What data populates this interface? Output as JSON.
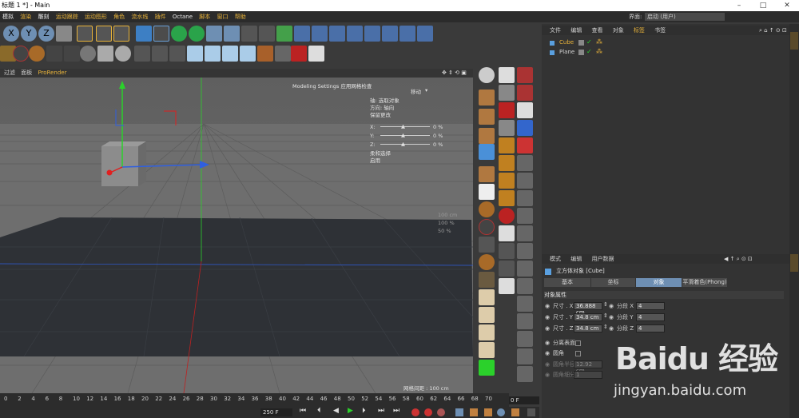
{
  "window": {
    "title": "标题 1 *] - Main",
    "minimize": "–",
    "maximize": "□",
    "close": "✕"
  },
  "menu": [
    "模拟",
    "渲染",
    "雕刻",
    "运动跟踪",
    "运动图形",
    "角色",
    "流水线",
    "插件",
    "Octane",
    "脚本",
    "窗口",
    "帮助"
  ],
  "layout": {
    "label": "界面:",
    "value": "启动 (用户)"
  },
  "viewport": {
    "menu": [
      "过滤",
      "面板",
      "ProRender"
    ],
    "header_text": "Modeling Settings 应用网格检查",
    "grid_label": "网格间距 : 100 cm",
    "tool_panel": {
      "dropdown": "移动",
      "lines": [
        "轴: 选取对象",
        "方向: 轴向",
        "保留更改",
        "",
        "X:",
        "Y:",
        "Z:",
        "柔和选择",
        "启用"
      ],
      "axis_values": [
        "0 %",
        "0 %",
        "0 %"
      ],
      "faded_values": [
        "100 cm",
        "100 %",
        "50 %"
      ]
    }
  },
  "object_manager": {
    "menu": [
      "文件",
      "编辑",
      "查看",
      "对象",
      "标签",
      "书签"
    ],
    "objects": [
      {
        "name": "Cube",
        "selected": true
      },
      {
        "name": "Plane",
        "selected": false
      }
    ]
  },
  "attribute_manager": {
    "menu": [
      "模式",
      "编辑",
      "用户数据"
    ],
    "object_title": "立方体对象 [Cube]",
    "tabs": [
      "基本",
      "坐标",
      "对象",
      "平滑着色(Phong)"
    ],
    "active_tab": "对象",
    "section": "对象属性",
    "props": [
      {
        "label": "尺寸 . X",
        "value": "36.888 cm",
        "seg_label": "分段 X",
        "seg_value": "4"
      },
      {
        "label": "尺寸 . Y",
        "value": "34.8 cm",
        "seg_label": "分段 Y",
        "seg_value": "4"
      },
      {
        "label": "尺寸 . Z",
        "value": "34.8 cm",
        "seg_label": "分段 Z",
        "seg_value": "4"
      }
    ],
    "separate_surfaces": "分离表面",
    "fillet": "圆角",
    "fillet_radius": {
      "label": "圆角半径",
      "value": "12.92 cm"
    },
    "fillet_subdiv": {
      "label": "圆角细分",
      "value": "1"
    }
  },
  "timeline": {
    "ticks": [
      "0",
      "2",
      "4",
      "6",
      "8",
      "10",
      "12",
      "14",
      "16",
      "18",
      "20",
      "22",
      "24",
      "26",
      "28",
      "30",
      "32",
      "34",
      "36",
      "38",
      "40",
      "42",
      "44",
      "46",
      "48",
      "50",
      "52",
      "54",
      "56",
      "58",
      "60",
      "62",
      "64",
      "66",
      "68",
      "70"
    ],
    "frame": "0 F",
    "end_frame": "250 F"
  },
  "watermark": {
    "brand": "Baidu 经验",
    "url": "jingyan.baidu.com"
  },
  "colors": {
    "accent": "#e8b33a",
    "selection": "#6e8fb3",
    "y_axis": "#2bd12b",
    "x_axis": "#e02020",
    "z_axis": "#2f5fe0"
  }
}
